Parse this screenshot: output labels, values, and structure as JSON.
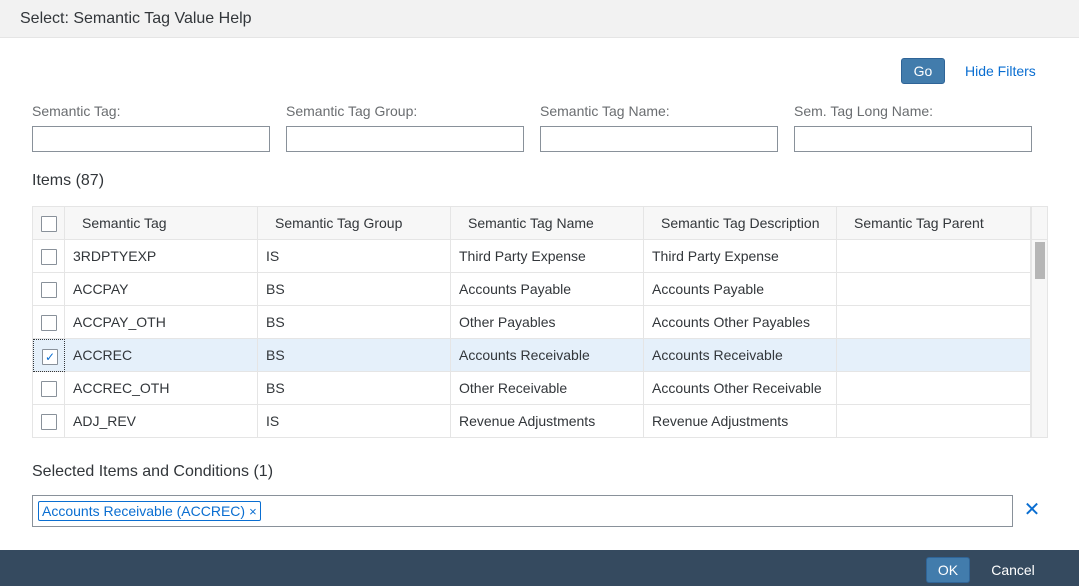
{
  "dialog": {
    "title": "Select: Semantic Tag Value Help"
  },
  "toolbar": {
    "go_label": "Go",
    "hide_filters_label": "Hide Filters"
  },
  "filters": [
    {
      "label": "Semantic Tag:",
      "value": ""
    },
    {
      "label": "Semantic Tag Group:",
      "value": ""
    },
    {
      "label": "Semantic Tag Name:",
      "value": ""
    },
    {
      "label": "Sem. Tag Long Name:",
      "value": ""
    }
  ],
  "items": {
    "title": "Items (87)",
    "columns": [
      "Semantic Tag",
      "Semantic Tag Group",
      "Semantic Tag Name",
      "Semantic Tag Description",
      "Semantic Tag Parent"
    ],
    "rows": [
      {
        "tag": "3RDPTYEXP",
        "group": "IS",
        "name": "Third Party Expense",
        "description": "Third Party Expense",
        "parent": "",
        "checked": false
      },
      {
        "tag": "ACCPAY",
        "group": "BS",
        "name": "Accounts Payable",
        "description": "Accounts Payable",
        "parent": "",
        "checked": false
      },
      {
        "tag": "ACCPAY_OTH",
        "group": "BS",
        "name": "Other Payables",
        "description": "Accounts Other Payables",
        "parent": "",
        "checked": false
      },
      {
        "tag": "ACCREC",
        "group": "BS",
        "name": "Accounts Receivable",
        "description": "Accounts Receivable",
        "parent": "",
        "checked": true
      },
      {
        "tag": "ACCREC_OTH",
        "group": "BS",
        "name": "Other Receivable",
        "description": "Accounts Other Receivable",
        "parent": "",
        "checked": false
      },
      {
        "tag": "ADJ_REV",
        "group": "IS",
        "name": "Revenue Adjustments",
        "description": "Revenue Adjustments",
        "parent": "",
        "checked": false
      }
    ]
  },
  "selected": {
    "title": "Selected Items and Conditions (1)",
    "tokens": [
      "Accounts Receivable (ACCREC)"
    ],
    "token_remove_glyph": "×",
    "clear_glyph": "✕"
  },
  "footer": {
    "ok_label": "OK",
    "cancel_label": "Cancel"
  },
  "icons": {
    "checkmark": "✓"
  },
  "colors": {
    "accent": "#427cac",
    "link": "#0a6ed1",
    "footer_bg": "#354a5f",
    "selected_row": "#e5f0fa"
  }
}
